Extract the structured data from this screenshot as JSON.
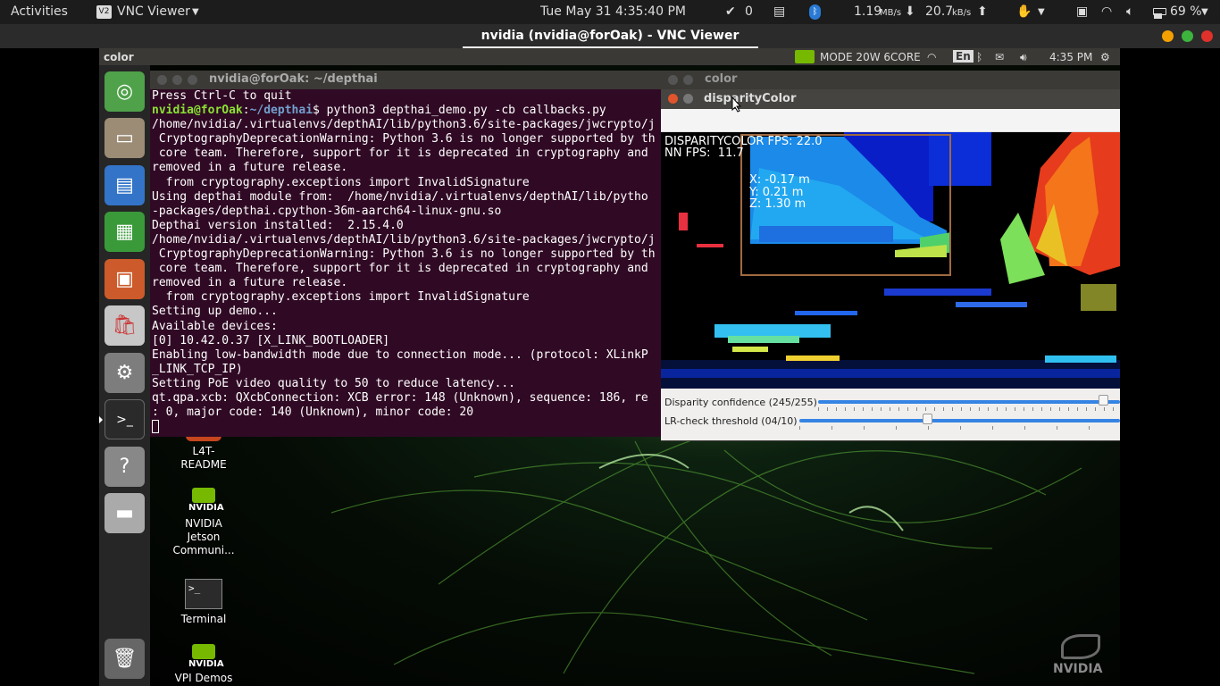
{
  "topbar": {
    "activities": "Activities",
    "app_menu": "VNC Viewer",
    "clock": "Tue May 31   4:35:40 PM",
    "check_count": "0",
    "net_down_value": "1.19",
    "net_down_unit": "MB/s",
    "net_up_value": "20.7",
    "net_up_unit": "kB/s",
    "battery": "69 %"
  },
  "vnc_window": {
    "title": "nvidia (nvidia@forOak) - VNC Viewer"
  },
  "remote_panel": {
    "window_name": "color",
    "power_mode": "MODE 20W 6CORE",
    "keyboard": "En",
    "time": "4:35 PM"
  },
  "terminal": {
    "title": "nvidia@forOak: ~/depthai",
    "prompt_user": "nvidia@forOak",
    "prompt_path": "~/depthai",
    "command": "$ python3 depthai_demo.py -cb callbacks.py",
    "lines_before": [
      "Press Ctrl-C to quit"
    ],
    "lines_after": [
      "/home/nvidia/.virtualenvs/depthAI/lib/python3.6/site-packages/jwcrypto/j",
      " CryptographyDeprecationWarning: Python 3.6 is no longer supported by th",
      " core team. Therefore, support for it is deprecated in cryptography and",
      "removed in a future release.",
      "  from cryptography.exceptions import InvalidSignature",
      "Using depthai module from:  /home/nvidia/.virtualenvs/depthAI/lib/pytho",
      "-packages/depthai.cpython-36m-aarch64-linux-gnu.so",
      "Depthai version installed:  2.15.4.0",
      "/home/nvidia/.virtualenvs/depthAI/lib/python3.6/site-packages/jwcrypto/j",
      " CryptographyDeprecationWarning: Python 3.6 is no longer supported by th",
      " core team. Therefore, support for it is deprecated in cryptography and",
      "removed in a future release.",
      "  from cryptography.exceptions import InvalidSignature",
      "Setting up demo...",
      "Available devices:",
      "[0] 10.42.0.37 [X_LINK_BOOTLOADER]",
      "Enabling low-bandwidth mode due to connection mode... (protocol: XLinkP",
      "_LINK_TCP_IP)",
      "Setting PoE video quality to 50 to reduce latency...",
      "qt.qpa.xcb: QXcbConnection: XCB error: 148 (Unknown), sequence: 186, re",
      ": 0, major code: 140 (Unknown), minor code: 20"
    ]
  },
  "color_window": {
    "title": "color"
  },
  "disparity_window": {
    "title": "disparityColor",
    "fps": "DISPARITYCOLOR FPS: 22.0",
    "nn_fps": "NN FPS:  11.7",
    "coord_x": "X: -0.17 m",
    "coord_y": "Y: 0.21 m",
    "coord_z": "Z: 1.30 m",
    "sliders": [
      {
        "label": "Disparity confidence (245/255)",
        "value": 245,
        "max": 255
      },
      {
        "label": "LR-check threshold (04/10)",
        "value": 4,
        "max": 10
      }
    ]
  },
  "desktop_icons": {
    "readme_line1": "L4T-",
    "readme_line2": "README",
    "jetson_logo": "NVIDIA",
    "jetson_line1": "NVIDIA",
    "jetson_line2": "Jetson",
    "jetson_line3": "Communi...",
    "terminal": "Terminal",
    "vpi_logo": "NVIDIA",
    "vpi": "VPI Demos"
  },
  "wallpaper_logo": "NVIDIA"
}
